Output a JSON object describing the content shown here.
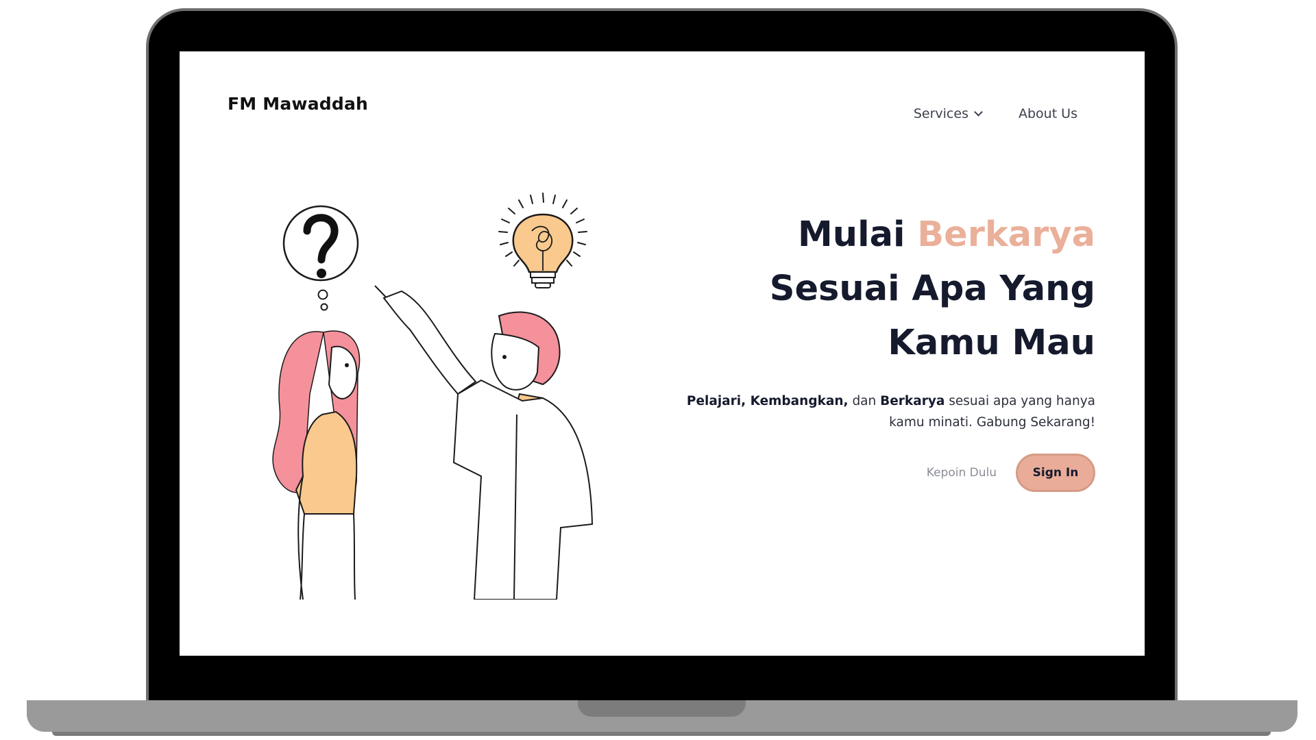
{
  "header": {
    "brand": "FM Mawaddah",
    "nav": [
      {
        "label": "Services",
        "has_dropdown": true
      },
      {
        "label": "About Us",
        "has_dropdown": false
      }
    ]
  },
  "hero": {
    "headline": {
      "line1_prefix": "Mulai ",
      "line1_accent": "Berkarya",
      "line2": "Sesuai Apa Yang",
      "line3": "Kamu Mau"
    },
    "subtitle": {
      "bold1": "Pelajari, Kembangkan,",
      "text1": " dan ",
      "bold2": "Berkarya",
      "text2": " sesuai apa yang hanya",
      "line2": "kamu minati. Gabung Sekarang!"
    },
    "secondary_cta": "Kepoin Dulu",
    "primary_cta": "Sign In"
  },
  "illustration": {
    "icons": [
      "question-mark-icon",
      "lightbulb-icon"
    ]
  },
  "colors": {
    "accent": "#eab09a",
    "dark_text": "#151a2d",
    "hair_pink": "#f4919b",
    "shirt_orange": "#f9c98d",
    "laptop_frame": "#000000",
    "laptop_base": "#9a9a9a"
  }
}
